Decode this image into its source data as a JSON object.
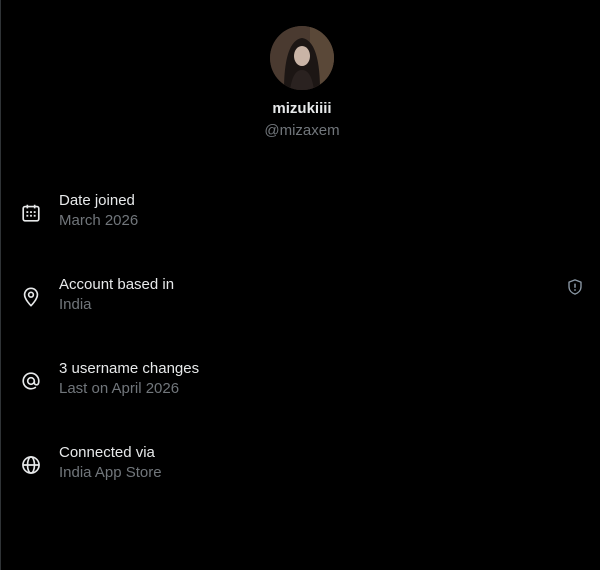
{
  "profile": {
    "display_name": "mizukiiii",
    "handle": "@mizaxem"
  },
  "details": [
    {
      "icon": "calendar-icon",
      "title": "Date joined",
      "value": "March 2026"
    },
    {
      "icon": "location-pin-icon",
      "title": "Account based in",
      "value": "India",
      "badge_icon": "shield-info-icon"
    },
    {
      "icon": "at-sign-icon",
      "title": "3 username changes",
      "value": "Last on April 2026"
    },
    {
      "icon": "globe-icon",
      "title": "Connected via",
      "value": "India App Store"
    }
  ],
  "colors": {
    "background": "#000000",
    "primary_text": "#e7e9ea",
    "secondary_text": "#71767b",
    "border": "#2f3336"
  }
}
